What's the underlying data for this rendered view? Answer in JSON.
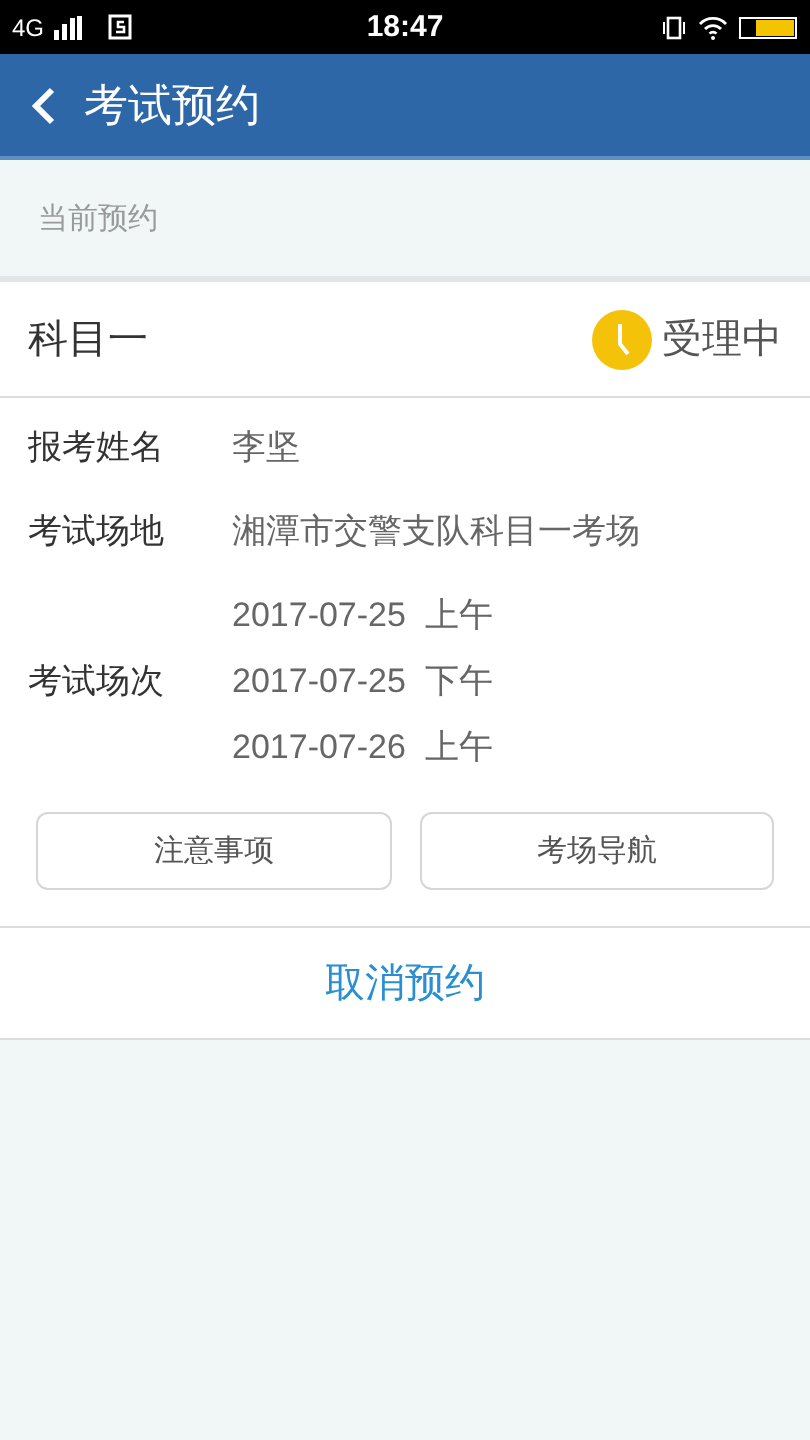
{
  "status_bar": {
    "network": "4G",
    "time": "18:47"
  },
  "header": {
    "title": "考试预约"
  },
  "section_label": "当前预约",
  "booking": {
    "subject": "科目一",
    "status": "受理中",
    "fields": [
      {
        "label": "报考姓名",
        "values": [
          "李坚"
        ]
      },
      {
        "label": "考试场地",
        "values": [
          "湘潭市交警支队科目一考场"
        ]
      },
      {
        "label": "考试场次",
        "values": [
          "2017-07-25  上午",
          "2017-07-25  下午",
          "2017-07-26  上午"
        ]
      }
    ],
    "buttons": [
      "注意事项",
      "考场导航"
    ],
    "cancel": "取消预约"
  }
}
